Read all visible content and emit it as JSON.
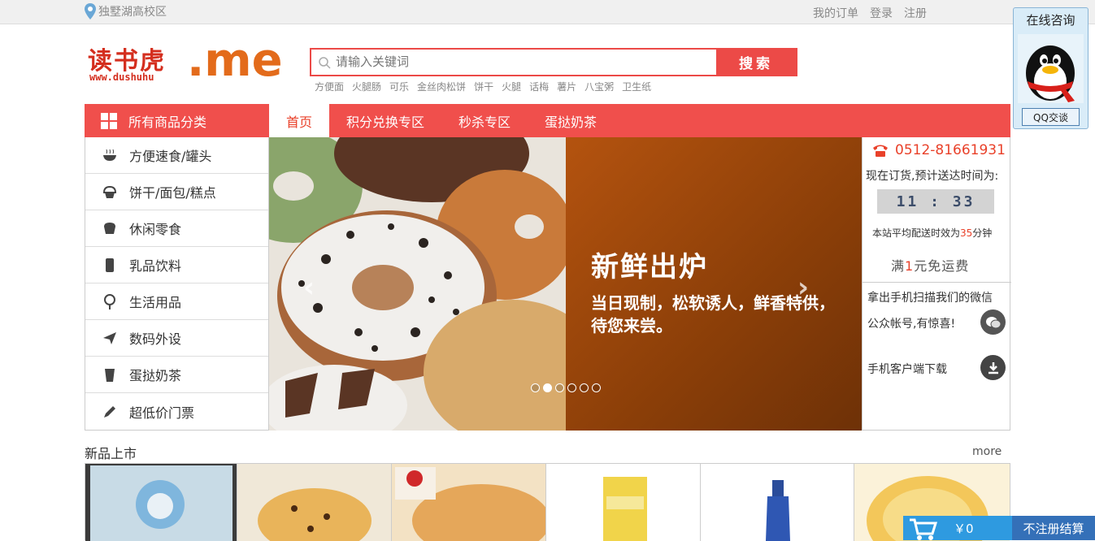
{
  "topbar": {
    "location": "独墅湖高校区",
    "links": [
      "我的订单",
      "登录",
      "注册"
    ]
  },
  "logo": {
    "cn": "读书虎",
    "en": "www.dushuhu",
    "me": ".me"
  },
  "search": {
    "placeholder": "请输入关键词",
    "button": "搜索"
  },
  "hot_keywords": [
    "方便面",
    "火腿肠",
    "可乐",
    "金丝肉松饼",
    "饼干",
    "火腿",
    "话梅",
    "薯片",
    "八宝粥",
    "卫生纸"
  ],
  "nav": {
    "all_categories": "所有商品分类",
    "items": [
      "首页",
      "积分兑换专区",
      "秒杀专区",
      "蛋挞奶茶"
    ]
  },
  "categories": [
    {
      "label": "方便速食/罐头",
      "icon": "bowl-icon"
    },
    {
      "label": "饼干/面包/糕点",
      "icon": "cupcake-icon"
    },
    {
      "label": "休闲零食",
      "icon": "snack-icon"
    },
    {
      "label": "乳品饮料",
      "icon": "drink-icon"
    },
    {
      "label": "生活用品",
      "icon": "lollipop-icon"
    },
    {
      "label": "数码外设",
      "icon": "plane-icon"
    },
    {
      "label": "蛋挞奶茶",
      "icon": "cup-icon"
    },
    {
      "label": "超低价门票",
      "icon": "pencil-icon"
    }
  ],
  "banner": {
    "headline": "新鲜出炉",
    "subtext": "当日现制，松软诱人，鲜香特供，待您来尝。",
    "slide_count": 6,
    "active_slide": 2
  },
  "sidebar": {
    "phone": "0512-81661931",
    "order_text": "现在订货,预计送达时间为:",
    "delivery_time": "11 : 33",
    "avg_prefix": "本站平均配送时效为",
    "avg_value": "35",
    "avg_suffix": "分钟",
    "free_prefix": "满",
    "free_value": "1",
    "free_suffix": "元免运费",
    "wechat_line1": "拿出手机扫描我们的微信",
    "wechat_line2": "公众帐号,有惊喜!",
    "download": "手机客户端下载"
  },
  "new_products": {
    "title": "新品上市",
    "more": "more"
  },
  "products_count": 6,
  "qq": {
    "title": "在线咨询",
    "button": "QQ交谈"
  },
  "cart": {
    "amount": "￥0",
    "checkout": "不注册结算"
  },
  "colors": {
    "brand_red": "#f04f4c",
    "accent_orange": "#e36b1b",
    "cart_blue": "#2e9ae0"
  }
}
